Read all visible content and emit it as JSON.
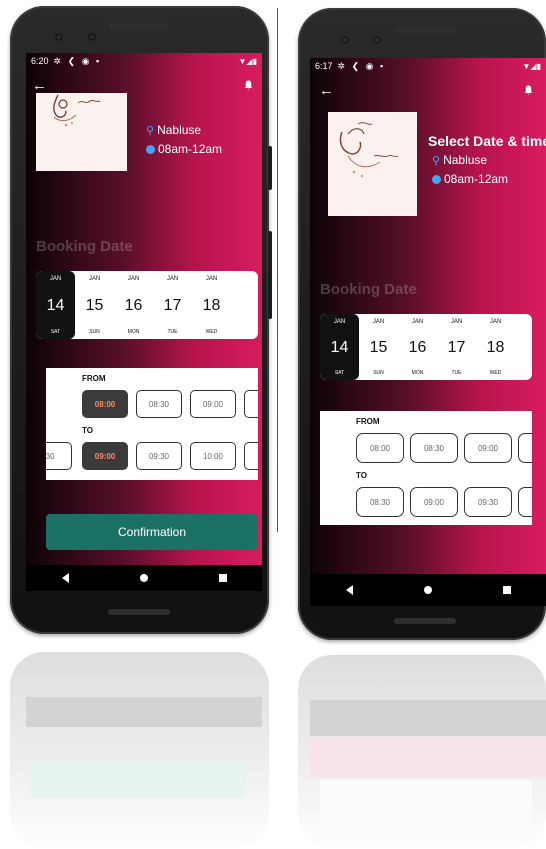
{
  "left_phone": {
    "status_time": "6:20",
    "location": "Nabluse",
    "hours": "08am-12am",
    "section_title": "Booking Date",
    "dates": [
      {
        "month": "JAN",
        "day": "14",
        "weekday": "SAT",
        "selected": true
      },
      {
        "month": "JAN",
        "day": "15",
        "weekday": "SUN",
        "selected": false
      },
      {
        "month": "JAN",
        "day": "16",
        "weekday": "MON",
        "selected": false
      },
      {
        "month": "JAN",
        "day": "17",
        "weekday": "TUE",
        "selected": false
      },
      {
        "month": "JAN",
        "day": "18",
        "weekday": "WED",
        "selected": false
      }
    ],
    "from_label": "FROM",
    "to_label": "TO",
    "from_slots": [
      {
        "t": "08:00",
        "selected": true
      },
      {
        "t": "08:30",
        "selected": false
      },
      {
        "t": "09:00",
        "selected": false
      }
    ],
    "to_slots": [
      {
        "t": ":30",
        "selected": false
      },
      {
        "t": "09:00",
        "selected": true
      },
      {
        "t": "09:30",
        "selected": false
      },
      {
        "t": "10:00",
        "selected": false
      }
    ],
    "confirm_label": "Confirmation"
  },
  "right_phone": {
    "status_time": "6:17",
    "title": "Select Date & time",
    "location": "Nabluse",
    "hours": "08am-12am",
    "section_title": "Booking Date",
    "dates": [
      {
        "month": "JAN",
        "day": "14",
        "weekday": "SAT",
        "selected": true
      },
      {
        "month": "JAN",
        "day": "15",
        "weekday": "SUN",
        "selected": false
      },
      {
        "month": "JAN",
        "day": "16",
        "weekday": "MON",
        "selected": false
      },
      {
        "month": "JAN",
        "day": "17",
        "weekday": "TUE",
        "selected": false
      },
      {
        "month": "JAN",
        "day": "18",
        "weekday": "WED",
        "selected": false
      }
    ],
    "from_label": "FROM",
    "to_label": "TO",
    "from_slots": [
      {
        "t": "08:00",
        "selected": false
      },
      {
        "t": "08:30",
        "selected": false
      },
      {
        "t": "09:00",
        "selected": false
      }
    ],
    "to_slots": [
      {
        "t": "08:30",
        "selected": false
      },
      {
        "t": "09:00",
        "selected": false
      },
      {
        "t": "09:30",
        "selected": false
      }
    ]
  },
  "colors": {
    "gradient_dark": "#0c0307",
    "gradient_pink": "#d81b60",
    "confirm_green": "#1b7163",
    "selected_time_text": "#ff8a65",
    "icon_blue": "#42a5f5"
  }
}
